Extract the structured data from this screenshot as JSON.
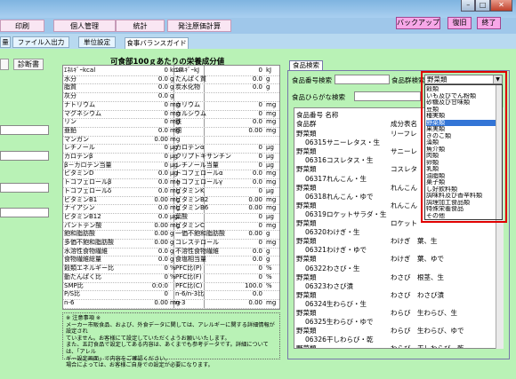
{
  "menu": {
    "tabs": [
      "印刷",
      "個人管理",
      "統計",
      "発注原価計算"
    ],
    "backup": "バックアップ",
    "restore": "復旧",
    "exit": "終了"
  },
  "subtabs": [
    "量",
    "ファイル入出力",
    "単位設定",
    "食事バランスガイド"
  ],
  "left": {
    "diag_button": "診断書"
  },
  "nutrition": {
    "title": "可食部100ｇあたりの栄養成分値",
    "rows": [
      {
        "n1": "ｴﾈﾙｷﾞｰkcal",
        "v1": "0",
        "u1": "kcal",
        "n2": "ｴﾈﾙｷﾞｰkJ",
        "v2": "0",
        "u2": "kJ"
      },
      {
        "n1": "水分",
        "v1": "0.0",
        "u1": "g",
        "n2": "たんぱく質",
        "v2": "0.0",
        "u2": "g"
      },
      {
        "n1": "脂質",
        "v1": "0.0",
        "u1": "g",
        "n2": "炭水化物",
        "v2": "0.0",
        "u2": "g"
      },
      {
        "n1": "灰分",
        "v1": "0.0",
        "u1": "g",
        "n2": "",
        "v2": "",
        "u2": ""
      },
      {
        "n1": "ナトリウム",
        "v1": "0",
        "u1": "mg",
        "n2": "カリウム",
        "v2": "0",
        "u2": "mg"
      },
      {
        "n1": "マグネシウム",
        "v1": "0",
        "u1": "mg",
        "n2": "カルシウム",
        "v2": "0",
        "u2": "mg"
      },
      {
        "n1": "リン",
        "v1": "0",
        "u1": "mg",
        "n2": "鉄",
        "v2": "0.0",
        "u2": "mg"
      },
      {
        "n1": "亜鉛",
        "v1": "0.0",
        "u1": "mg",
        "n2": "銅",
        "v2": "0.00",
        "u2": "mg"
      },
      {
        "n1": "マンガン",
        "v1": "0.00",
        "u1": "mg",
        "n2": "",
        "v2": "",
        "u2": ""
      },
      {
        "n1": "レチノール",
        "v1": "0",
        "u1": "μg",
        "n2": "カロテンα",
        "v2": "0",
        "u2": "μg"
      },
      {
        "n1": "カロテンβ",
        "v1": "0",
        "u1": "μg",
        "n2": "クリプトキサンチン",
        "v2": "0",
        "u2": "μg"
      },
      {
        "n1": "β－カロテン当量",
        "v1": "0",
        "u1": "μg",
        "n2": "レチノール当量",
        "v2": "0",
        "u2": "μg"
      },
      {
        "n1": "ビタミンD",
        "v1": "0.0",
        "u1": "μg",
        "n2": "トコフェロールα",
        "v2": "0.0",
        "u2": "mg"
      },
      {
        "n1": "トコフェロールβ",
        "v1": "0.0",
        "u1": "mg",
        "n2": "トコフェロールγ",
        "v2": "0.0",
        "u2": "mg"
      },
      {
        "n1": "トコフェロールδ",
        "v1": "0.0",
        "u1": "mg",
        "n2": "ビタミンK",
        "v2": "0",
        "u2": "μg"
      },
      {
        "n1": "ビタミンB1",
        "v1": "0.00",
        "u1": "mg",
        "n2": "ビタミンB2",
        "v2": "0.00",
        "u2": "mg"
      },
      {
        "n1": "ナイアシン",
        "v1": "0.0",
        "u1": "mg",
        "n2": "ビタミンB6",
        "v2": "0.00",
        "u2": "mg"
      },
      {
        "n1": "ビタミンB12",
        "v1": "0.0",
        "u1": "μg",
        "n2": "葉酸",
        "v2": "0",
        "u2": "μg"
      },
      {
        "n1": "パントテン酸",
        "v1": "0.00",
        "u1": "mg",
        "n2": "ビタミンC",
        "v2": "0",
        "u2": "mg"
      },
      {
        "n1": "飽和脂肪酸",
        "v1": "0.00",
        "u1": "g",
        "n2": "一価不飽和脂肪酸",
        "v2": "0.00",
        "u2": "g"
      },
      {
        "n1": "多価不飽和脂肪酸",
        "v1": "0.00",
        "u1": "g",
        "n2": "コレステロール",
        "v2": "0",
        "u2": "mg"
      },
      {
        "n1": "水溶性食物繊維",
        "v1": "0.0",
        "u1": "g",
        "n2": "不溶性食物繊維",
        "v2": "0.0",
        "u2": "g"
      },
      {
        "n1": "食物繊維総量",
        "v1": "0.0",
        "u1": "g",
        "n2": "食塩相当量",
        "v2": "0.0",
        "u2": "g"
      },
      {
        "n1": "穀類エネルギー比",
        "v1": "0",
        "u1": "%",
        "n2": "PFC比(P)",
        "v2": "0",
        "u2": "%"
      },
      {
        "n1": "動たんぱく比",
        "v1": "0",
        "u1": "%",
        "n2": "PFC比(F)",
        "v2": "0",
        "u2": "%"
      },
      {
        "n1": "SMP比",
        "v1": "0:0:0",
        "u1": "",
        "n2": "PFC比(C)",
        "v2": "100.0",
        "u2": "%"
      },
      {
        "n1": "P/S比",
        "v1": "0",
        "u1": "",
        "n2": "n-6/n-3比",
        "v2": "0.0",
        "u2": ""
      },
      {
        "n1": "n-6",
        "v1": "0.00",
        "u1": "mg",
        "n2": "n-3",
        "v2": "0.00",
        "u2": "mg"
      }
    ]
  },
  "notes": {
    "title": "※ 注意事項 ※",
    "lines": [
      "メーカー市販食品、および、外食データに関しては、アレルギーに関する詳細情報が設定され",
      "ていません。お客様にて設定していただくようお願いいたします。",
      "また、五訂食品で設定してある内容は、あくまでも参考データです。詳細については、「アレル",
      "ギー設定画面」で内容をご確認ください。",
      "場合によっては、お客様ご自身での設定が必要になります。"
    ]
  },
  "search": {
    "tab": "食品検索",
    "by_number_label": "食品番号検索",
    "category_label": "食品群検索",
    "category_value": "野菜類",
    "hiragana_label": "食品ひらがな検索",
    "col_number_name": "食品番号 名称",
    "col_group": "食品群",
    "col_ingredient": "成分表名",
    "results": [
      {
        "group": "野菜類",
        "num": "",
        "name": "",
        "ing": "リーフレ"
      },
      {
        "group": "",
        "num": "06315",
        "name": "サニーレタス・生",
        "ing": ""
      },
      {
        "group": "野菜類",
        "num": "",
        "name": "",
        "ing": "サニーレ"
      },
      {
        "group": "",
        "num": "06316",
        "name": "コスレタス・生",
        "ing": ""
      },
      {
        "group": "野菜類",
        "num": "",
        "name": "",
        "ing": "コスレタ"
      },
      {
        "group": "",
        "num": "06317",
        "name": "れんこん・生",
        "ing": ""
      },
      {
        "group": "野菜類",
        "num": "",
        "name": "",
        "ing": "れんこん"
      },
      {
        "group": "",
        "num": "06318",
        "name": "れんこん・ゆで",
        "ing": ""
      },
      {
        "group": "野菜類",
        "num": "",
        "name": "",
        "ing": "れんこん"
      },
      {
        "group": "",
        "num": "06319",
        "name": "ロケットサラダ・生",
        "ing": ""
      },
      {
        "group": "野菜類",
        "num": "",
        "name": "",
        "ing": "ロケット"
      },
      {
        "group": "",
        "num": "06320",
        "name": "わけぎ・生",
        "ing": ""
      },
      {
        "group": "野菜類",
        "num": "",
        "name": "",
        "ing": "わけぎ　葉、生"
      },
      {
        "group": "",
        "num": "06321",
        "name": "わけぎ・ゆで",
        "ing": ""
      },
      {
        "group": "野菜類",
        "num": "",
        "name": "",
        "ing": "わけぎ　葉、ゆで"
      },
      {
        "group": "",
        "num": "06322",
        "name": "わさび・生",
        "ing": ""
      },
      {
        "group": "野菜類",
        "num": "",
        "name": "",
        "ing": "わさび　根茎、生"
      },
      {
        "group": "",
        "num": "06323",
        "name": "わさび漬",
        "ing": ""
      },
      {
        "group": "野菜類",
        "num": "",
        "name": "",
        "ing": "わさび　わさび漬"
      },
      {
        "group": "",
        "num": "06324",
        "name": "生わらび・生",
        "ing": ""
      },
      {
        "group": "野菜類",
        "num": "",
        "name": "",
        "ing": "わらび　生わらび、生"
      },
      {
        "group": "",
        "num": "06325",
        "name": "生わらび・ゆで",
        "ing": ""
      },
      {
        "group": "野菜類",
        "num": "",
        "name": "",
        "ing": "わらび　生わらび、ゆで"
      },
      {
        "group": "",
        "num": "06326",
        "name": "干しわらび・乾",
        "ing": ""
      },
      {
        "group": "野菜類",
        "num": "",
        "name": "",
        "ing": "わらび　干しわらび、乾"
      }
    ],
    "dropdown": [
      "穀類",
      "いも及びでん粉類",
      "砂糖及び甘味類",
      "豆類",
      "種実類",
      "野菜類",
      "果実類",
      "きのこ類",
      "藻類",
      "魚介類",
      "肉類",
      "卵類",
      "乳類",
      "油脂類",
      "菓子類",
      "し好飲料類",
      "調味料及び香辛料類",
      "調理加工食品類",
      "特殊栄養食品",
      "その他"
    ],
    "selected_index": 5
  },
  "colors": {
    "green": "#b9f2b6",
    "pink": "#f7a8e8",
    "highlight": "#3375d6",
    "alert_border": "#e00000"
  }
}
